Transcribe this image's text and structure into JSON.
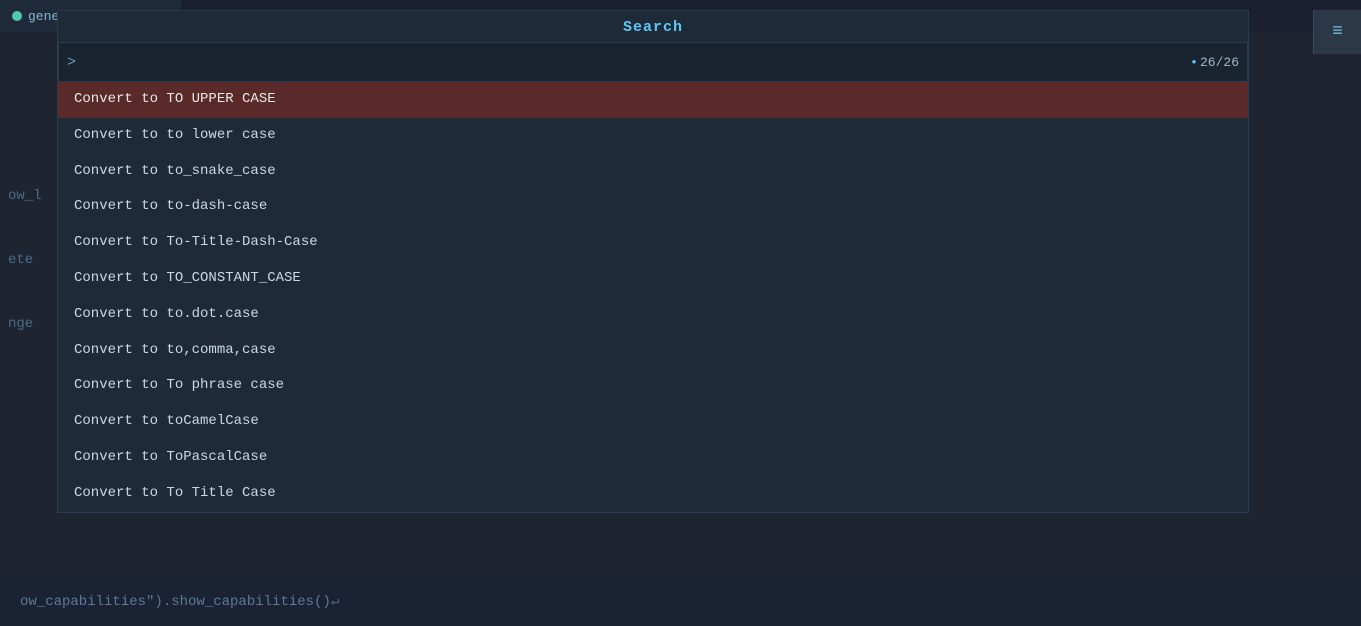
{
  "tab": {
    "dot_icon": "●",
    "label": "generate_doc.lua",
    "close_icon": "×"
  },
  "search": {
    "title": "Search",
    "prompt": ">",
    "input_value": "",
    "counter": "26/26",
    "counter_bullet": "•"
  },
  "right_button": {
    "icon": "≡"
  },
  "dropdown": {
    "items": [
      {
        "label": "Convert to TO UPPER CASE",
        "selected": true
      },
      {
        "label": "Convert to to lower case",
        "selected": false
      },
      {
        "label": "Convert to to_snake_case",
        "selected": false
      },
      {
        "label": "Convert to to-dash-case",
        "selected": false
      },
      {
        "label": "Convert to To-Title-Dash-Case",
        "selected": false
      },
      {
        "label": "Convert to TO_CONSTANT_CASE",
        "selected": false
      },
      {
        "label": "Convert to to.dot.case",
        "selected": false
      },
      {
        "label": "Convert to to,comma,case",
        "selected": false
      },
      {
        "label": "Convert to To phrase case",
        "selected": false
      },
      {
        "label": "Convert to toCamelCase",
        "selected": false
      },
      {
        "label": "Convert to ToPascalCase",
        "selected": false
      },
      {
        "label": "Convert to To Title Case",
        "selected": false
      }
    ]
  },
  "gutter": {
    "items": [
      "ow_l",
      "",
      "",
      "",
      "ete",
      "",
      "",
      "",
      "nge",
      "",
      "",
      ""
    ]
  },
  "bottom_code": {
    "prefix": "ow_capabilities\").show_capabilities()",
    "suffix": "↵"
  }
}
